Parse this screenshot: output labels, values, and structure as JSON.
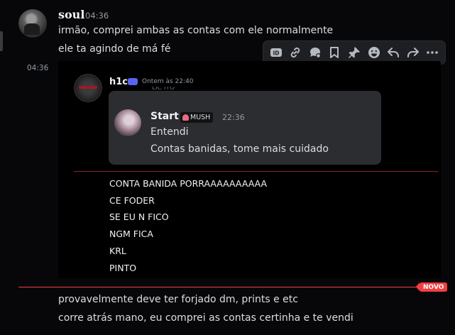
{
  "author": {
    "username": "soul",
    "timestamp": "04:36",
    "side_timestamp": "04:36"
  },
  "messages_top": [
    "irmão, comprei ambas as contas com ele normalmente",
    "ele ta agindo de má fé"
  ],
  "toolbar": {
    "icons": [
      "id-icon",
      "link-icon",
      "thread-icon",
      "bookmark-icon",
      "pin-icon",
      "emoji-icon",
      "reply-icon",
      "forward-icon",
      "more-icon"
    ]
  },
  "embedded": {
    "author": "h1c",
    "timestamp": "Ontem às 22:40",
    "clipped_text": "LIC ITO",
    "quote": {
      "author": "Start",
      "tag": "MUSH",
      "timestamp": "22:36",
      "lines": [
        "Entendi",
        "Contas banidas, tome mais cuidado"
      ]
    },
    "messages": [
      "CONTA BANIDA PORRAAAAAAAAAA",
      "CE FODER",
      "SE EU N FICO",
      "NGM FICA",
      "KRL",
      "PINTO"
    ]
  },
  "new_divider": {
    "label": "NOVO",
    "color": "#f23f43"
  },
  "messages_bottom": [
    "provavelmente deve ter forjado dm, prints e etc",
    "corre atrás mano, eu comprei as contas certinha e te vendi"
  ]
}
